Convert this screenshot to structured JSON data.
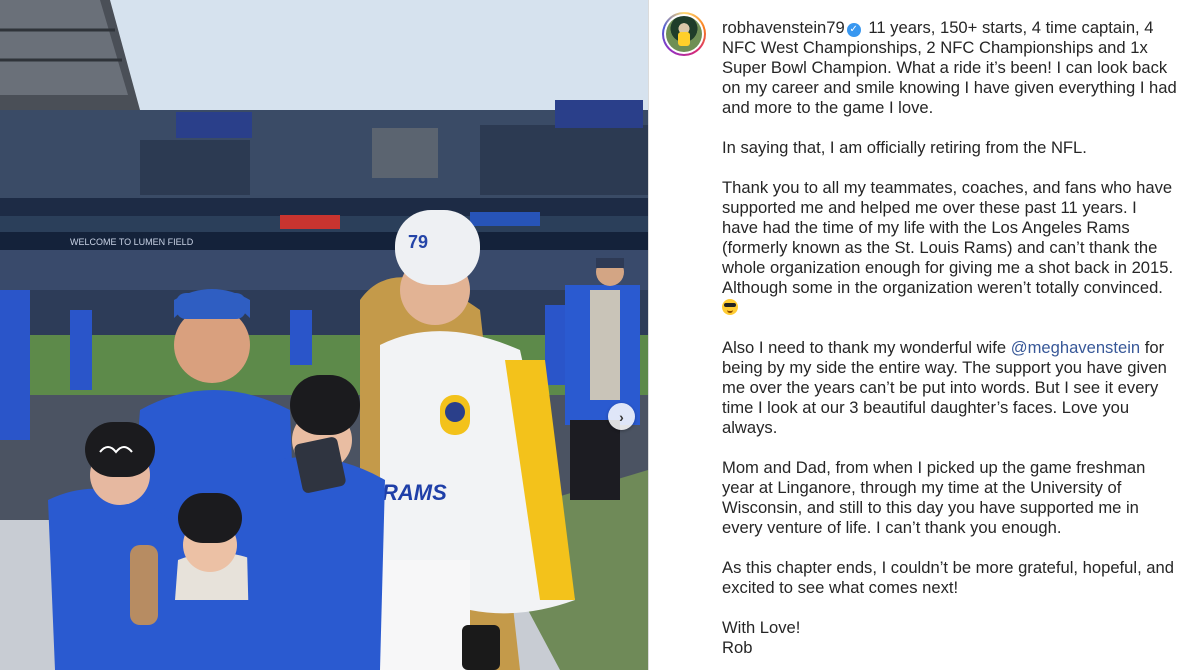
{
  "post": {
    "username": "robhavenstein79",
    "verified_icon": "verified-badge-icon",
    "next_icon": "chevron-right-icon",
    "next_symbol": "›",
    "mention": "@meghavenstein",
    "paragraphs": {
      "p1": "11 years, 150+ starts, 4 time captain, 4 NFC West Championships, 2 NFC Championships and 1x Super Bowl Champion. What a ride it’s been! I can look back on my career and smile knowing I have given everything I had and more to the game I love.",
      "p2": "In saying that, I am officially retiring from the NFL.",
      "p3": "Thank you to all my teammates, coaches, and fans who have supported me and helped me over these past 11 years. I have had the time of my life with the Los Angeles Rams (formerly known as the St. Louis Rams) and can’t thank the whole organization enough for giving me a shot back in 2015. Although some in the organization weren’t totally convinced.",
      "p3_emoji": "sunglasses-emoji",
      "p4_before": "Also I need to thank my wonderful wife",
      "p4_after": "for being by my side the entire way. The support you have given me over the years can’t be put into words. But I see it every time I look at our 3 beautiful daughter’s faces. Love you always.",
      "p5": "Mom and Dad, from when I picked up the game freshman year at Linganore, through my time at the University of Wisconsin, and still to this day you have supported me in every venture of life. I can’t thank you enough.",
      "p6": "As this chapter ends, I couldn’t be more grateful, hopeful, and excited to see what comes next!",
      "signoff_1": "With Love!",
      "signoff_2": "Rob"
    }
  },
  "photo": {
    "stadium_banner": "WELCOME TO LUMEN FIELD",
    "beanie_number": "79",
    "jacket_text": "RAMS"
  },
  "colors": {
    "mention": "#385898",
    "verified": "#3897f0",
    "rams_blue": "#1f4fbf",
    "rams_gold": "#f3c21b"
  }
}
